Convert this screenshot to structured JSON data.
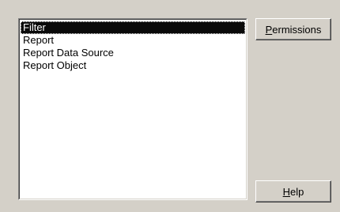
{
  "object_types": {
    "items": [
      {
        "label": "Filter",
        "selected": true
      },
      {
        "label": "Report",
        "selected": false
      },
      {
        "label": "Report Data Source",
        "selected": false
      },
      {
        "label": "Report Object",
        "selected": false
      }
    ]
  },
  "buttons": {
    "permissions": {
      "mnemonic": "P",
      "rest": "ermissions"
    },
    "help": {
      "mnemonic": "H",
      "rest": "elp"
    }
  },
  "colors": {
    "dialog_bg": "#d4d0c8",
    "selection_bg": "#0a0a0a",
    "selection_text": "#ffffff"
  }
}
